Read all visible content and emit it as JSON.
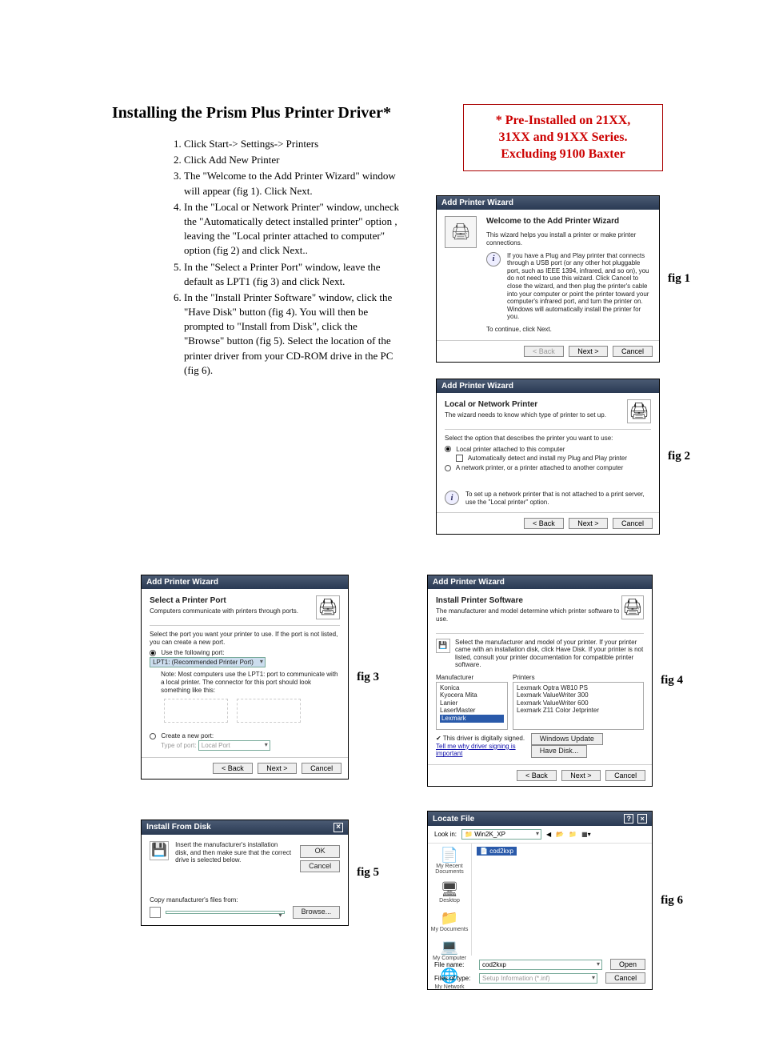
{
  "title": "Installing the Prism Plus Printer Driver*",
  "redbox": {
    "line1": "* Pre-Installed on 21XX,",
    "line2": "31XX and 91XX Series.",
    "line3": "Excluding 9100 Baxter"
  },
  "steps": [
    "Click Start-> Settings-> Printers",
    "Click Add New Printer",
    "The \"Welcome to the Add Printer Wizard\" window will appear (fig 1). Click Next.",
    "In the \"Local or Network Printer\" window, uncheck the \"Automatically detect installed printer\" option , leaving the \"Local printer attached to computer\" option (fig 2) and click Next..",
    "In the \"Select a Printer Port\" window, leave the default as LPT1 (fig 3) and click Next.",
    "In the \"Install Printer Software\" window, click the \"Have Disk\" button (fig 4).  You will then be prompted to \"Install from Disk\", click the \"Browse\" button (fig 5).  Select the location of the printer driver from your CD-ROM drive in the PC (fig 6)."
  ],
  "buttons": {
    "back": "< Back",
    "next": "Next >",
    "cancel": "Cancel",
    "ok": "OK",
    "browse": "Browse...",
    "open": "Open",
    "winupdate": "Windows Update",
    "havedisk": "Have Disk..."
  },
  "fig1": {
    "title": "Add Printer Wizard",
    "heading": "Welcome to the Add Printer Wizard",
    "line1": "This wizard helps you install a printer or make printer connections.",
    "info": "If you have a Plug and Play printer that connects through a USB port (or any other hot pluggable port, such as IEEE 1394, infrared, and so on), you do not need to use this wizard. Click Cancel to close the wizard, and then plug the printer's cable into your computer or point the printer toward your computer's infrared port, and turn the printer on. Windows will automatically install the printer for you.",
    "cont": "To continue, click Next.",
    "label": "fig 1"
  },
  "fig2": {
    "title": "Add Printer Wizard",
    "h": "Local or Network Printer",
    "sub": "The wizard needs to know which type of printer to set up.",
    "prompt": "Select the option that describes the printer you want to use:",
    "opt1": "Local printer attached to this computer",
    "opt1a": "Automatically detect and install my Plug and Play printer",
    "opt2": "A network printer, or a printer attached to another computer",
    "info": "To set up a network printer that is not attached to a print server, use the \"Local printer\" option.",
    "label": "fig 2"
  },
  "fig3": {
    "title": "Add Printer Wizard",
    "h": "Select a Printer Port",
    "sub": "Computers communicate with printers through ports.",
    "prompt": "Select the port you want your printer to use.  If the port is not listed, you can create a new port.",
    "useport": "Use the following port:",
    "portval": "LPT1: (Recommended Printer Port)",
    "note": "Note: Most computers use the LPT1: port to communicate with a local printer. The connector for this port should look something like this:",
    "create": "Create a new port:",
    "typeport": "Type of port:",
    "localport": "Local Port",
    "label": "fig 3"
  },
  "fig4": {
    "title": "Add Printer Wizard",
    "h": "Install Printer Software",
    "sub": "The manufacturer and model determine which printer software to use.",
    "prompt": "Select the manufacturer and model of your printer. If your printer came with an installation disk, click Have Disk. If your printer is not listed, consult your printer documentation for compatible printer software.",
    "mfr_h": "Manufacturer",
    "prn_h": "Printers",
    "mfrs": [
      "Konica",
      "Kyocera Mita",
      "Lanier",
      "LaserMaster",
      "Lexmark"
    ],
    "prns": [
      "Lexmark Optra W810 PS",
      "Lexmark ValueWriter 300",
      "Lexmark ValueWriter 600",
      "Lexmark Z11 Color Jetprinter"
    ],
    "signed": "This driver is digitally signed.",
    "tell": "Tell me why driver signing is important",
    "label": "fig 4"
  },
  "fig5": {
    "title": "Install From Disk",
    "line": "Insert the manufacturer's installation disk, and then make sure that the correct drive is selected below.",
    "copy": "Copy manufacturer's files from:",
    "label": "fig 5"
  },
  "fig6": {
    "title": "Locate File",
    "lookin": "Look in:",
    "folder": "Win2K_XP",
    "file": "cod2kxp",
    "places": [
      "My Recent Documents",
      "Desktop",
      "My Documents",
      "My Computer",
      "My Network"
    ],
    "filename_l": "File name:",
    "filename_v": "cod2kxp",
    "filesof_l": "Files of type:",
    "filesof_v": "Setup Information (*.inf)",
    "label": "fig 6"
  }
}
